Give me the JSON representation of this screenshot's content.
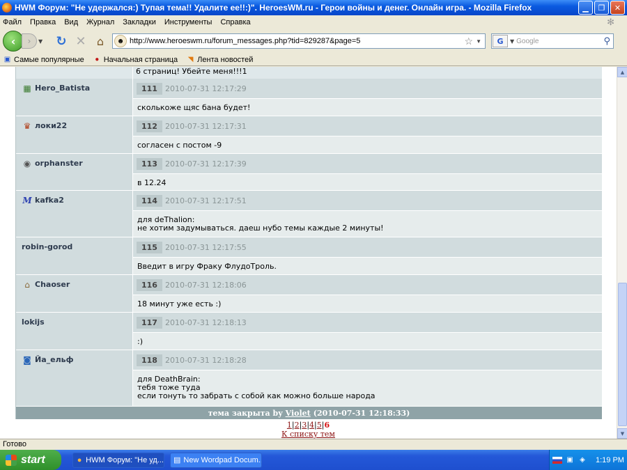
{
  "window": {
    "title": "HWM Форум: \"Не удержался:) Тупая тема!! Удалите ее!!:)\". HeroesWM.ru - Герои войны и денег. Онлайн игра. - Mozilla Firefox"
  },
  "menu": [
    "Файл",
    "Правка",
    "Вид",
    "Журнал",
    "Закладки",
    "Инструменты",
    "Справка"
  ],
  "nav": {
    "url": "http://www.heroeswm.ru/forum_messages.php?tid=829287&page=5",
    "search_placeholder": "Google",
    "search_engine": "G"
  },
  "bookmarks": [
    "Самые популярные",
    "Начальная страница",
    "Лента новостей"
  ],
  "forum": {
    "top_text": "6 страниц! Убейте меня!!!1",
    "posts": [
      {
        "author": "Hero_Batista",
        "icon": "guild-flag-icon",
        "glyph": "▦",
        "num": "111",
        "date": "2010-07-31 12:17:29",
        "lines": [
          "сколькоже щяс бана будет!"
        ]
      },
      {
        "author": "локи22",
        "icon": "crown-icon",
        "glyph": "♛",
        "num": "112",
        "date": "2010-07-31 12:17:31",
        "lines": [
          "согласен с постом -9"
        ]
      },
      {
        "author": "orphanster",
        "icon": "swirl-icon",
        "glyph": "◉",
        "num": "113",
        "date": "2010-07-31 12:17:39",
        "lines": [
          "в 12.24"
        ]
      },
      {
        "author": "kafka2",
        "icon": "letter-m-icon",
        "glyph": "M",
        "num": "114",
        "date": "2010-07-31 12:17:51",
        "lines": [
          "для deThalion:",
          "не хотим задумываться. даеш нубо темы каждые 2 минуты!"
        ]
      },
      {
        "author": "robin-gorod",
        "icon": "",
        "glyph": "",
        "num": "115",
        "date": "2010-07-31 12:17:55",
        "lines": [
          "Введит в игру Фраку ФлудоТроль."
        ]
      },
      {
        "author": "Chaoser",
        "icon": "hands-icon",
        "glyph": "⌂",
        "num": "116",
        "date": "2010-07-31 12:18:06",
        "lines": [
          "18 минут уже есть :)"
        ]
      },
      {
        "author": "lokijs",
        "icon": "",
        "glyph": "",
        "num": "117",
        "date": "2010-07-31 12:18:13",
        "lines": [
          ":)"
        ]
      },
      {
        "author": "Йа_ельф",
        "icon": "shield-icon",
        "glyph": "◙",
        "num": "118",
        "date": "2010-07-31 12:18:28",
        "lines": [
          "для DeathBrain:",
          "тебя тоже туда",
          "если тонуть то забрать с собой как можно больше народа"
        ]
      }
    ],
    "closed_prefix": "тема закрыта by",
    "closed_by": "Violet",
    "closed_time": "(2010-07-31 12:18:33)",
    "pages": [
      "1",
      "2",
      "3",
      "4",
      "5"
    ],
    "current_page": "6",
    "back_link": "К списку тем"
  },
  "status": "Готово",
  "taskbar": {
    "start": "start",
    "tasks": [
      "HWM Форум: \"Не уд...",
      "New Wordpad Docum..."
    ],
    "clock": "1:19 PM"
  }
}
